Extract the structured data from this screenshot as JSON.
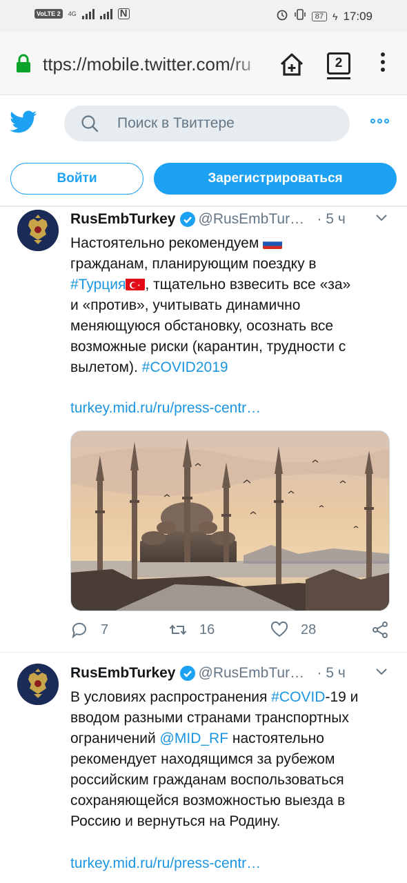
{
  "status_bar": {
    "carrier_badge": "VoLTE",
    "sim_number": "2",
    "network": "4G",
    "battery": "87",
    "time": "17:09"
  },
  "browser": {
    "url": "ttps://mobile.twitter.com/ru",
    "tab_count": "2"
  },
  "twitter_header": {
    "search_placeholder": "Поиск в Твиттере",
    "login_label": "Войти",
    "signup_label": "Зарегистрироваться",
    "accent_color": "#1da1f2"
  },
  "tweets": [
    {
      "name": "RusEmbTurkey",
      "handle": "@RusEmbTur…",
      "separator": "·",
      "time": "5 ч",
      "body_lines": [
        "Настоятельно рекомендуем",
        "гражданам, планирующим поездку в",
        "#Турция",
        ", тщательно взвесить все «за»",
        "и «против», учитывать динамично",
        "меняющуюся обстановку, осознать все",
        "возможные риски (карантин, трудности с",
        "вылетом). ",
        "#COVID2019"
      ],
      "link": "turkey.mid.ru/ru/press-centr…",
      "media_description_icon": "mosque-photo",
      "replies": "7",
      "retweets": "16",
      "likes": "28"
    },
    {
      "name": "RusEmbTurkey",
      "handle": "@RusEmbTur…",
      "separator": "·",
      "time": "5 ч",
      "body_parts": {
        "p1": "В условиях распространения ",
        "tag": "#COVID",
        "p2": "-19 и",
        "line2": "вводом разными странами транспортных",
        "p3": "ограничений ",
        "mention": "@MID_RF",
        "p4": " настоятельно",
        "line4": "рекомендует находящимся за рубежом",
        "line5": "российским гражданам воспользоваться",
        "line6": "сохраняющейся возможностью выезда в",
        "line7": "Россию и вернуться на Родину."
      },
      "link": "turkey.mid.ru/ru/press-centr…"
    }
  ]
}
